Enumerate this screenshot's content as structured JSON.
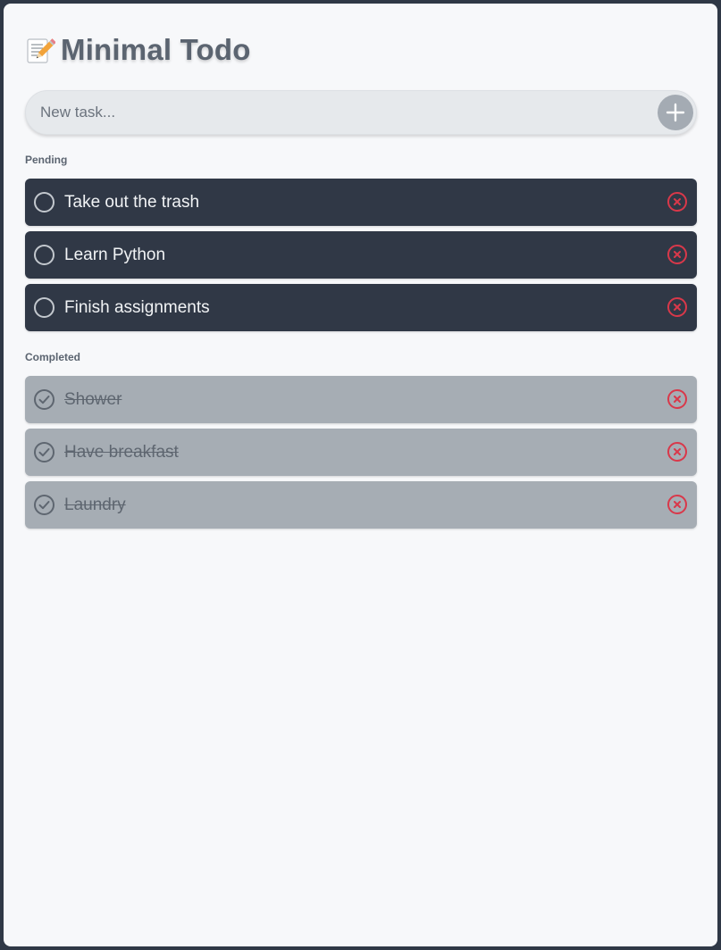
{
  "app": {
    "title": "Minimal Todo",
    "icon": "memo-pencil-icon"
  },
  "new_task": {
    "placeholder": "New task...",
    "value": "",
    "add_icon": "plus-icon"
  },
  "sections": {
    "pending_label": "Pending",
    "completed_label": "Completed"
  },
  "pending_tasks": [
    {
      "label": "Take out the trash"
    },
    {
      "label": "Learn Python"
    },
    {
      "label": "Finish assignments"
    }
  ],
  "completed_tasks": [
    {
      "label": "Shower"
    },
    {
      "label": "Have breakfast"
    },
    {
      "label": "Laundry"
    }
  ],
  "colors": {
    "pending_bg": "#303846",
    "completed_bg": "#a6adb4",
    "delete_red": "#d9384a",
    "page_bg": "#f7f8fa",
    "frame_bg": "#2f3846"
  }
}
